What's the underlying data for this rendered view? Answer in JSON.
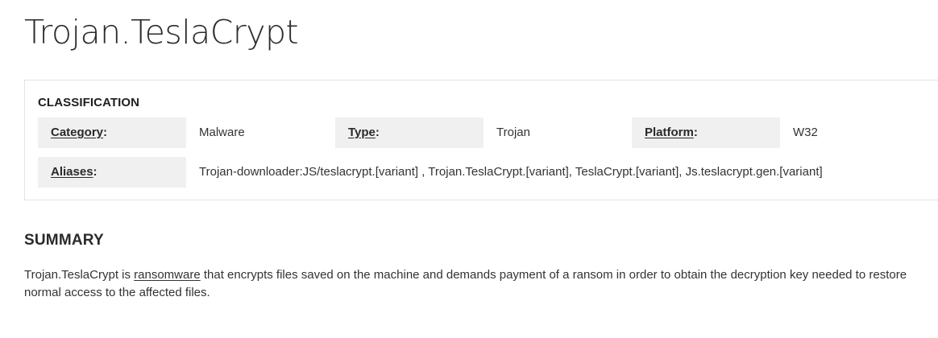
{
  "title": "Trojan.TeslaCrypt",
  "classification": {
    "heading": "CLASSIFICATION",
    "category_label": "Category",
    "category_value": "Malware",
    "type_label": "Type",
    "type_value": "Trojan",
    "platform_label": "Platform",
    "platform_value": "W32",
    "aliases_label": "Aliases",
    "aliases_value": "Trojan-downloader:JS/teslacrypt.[variant] , Trojan.TeslaCrypt.[variant], TeslaCrypt.[variant], Js.teslacrypt.gen.[variant]",
    "label_suffix": ":"
  },
  "summary": {
    "heading": "SUMMARY",
    "text_before_link": "Trojan.TeslaCrypt is ",
    "link_text": "ransomware",
    "text_after_link": " that encrypts files saved on the machine and demands payment of a ransom in order to obtain the decryption key needed to restore normal access to the affected files."
  }
}
